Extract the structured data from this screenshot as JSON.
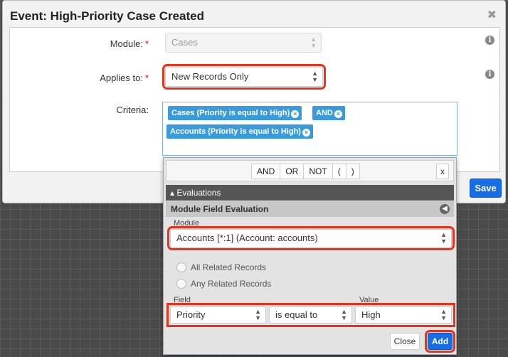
{
  "modal": {
    "title": "Event: High-Priority Case Created",
    "close_glyph": "✖",
    "save_label": "Save"
  },
  "form": {
    "module_label": "Module:",
    "module_value": "Cases",
    "applies_label": "Applies to:",
    "applies_value": "New Records Only",
    "criteria_label": "Criteria:",
    "required_mark": "*",
    "info_glyph": "i"
  },
  "criteria": {
    "pills": [
      {
        "label": "Cases (Priority is equal to High)"
      },
      {
        "label": "AND"
      },
      {
        "label": "Accounts (Priority is equal to High)"
      }
    ],
    "remove_glyph": "×"
  },
  "dropdown": {
    "operators": [
      "AND",
      "OR",
      "NOT",
      "(",
      ")"
    ],
    "close_glyph": "x",
    "evaluations_header": "▴ Evaluations",
    "section_title": "Module Field Evaluation",
    "back_glyph": "◀",
    "module_label": "Module",
    "module_value": "Accounts [*:1] (Account: accounts)",
    "radio_all": "All Related Records",
    "radio_any": "Any Related Records",
    "field_label": "Field",
    "value_label": "Value",
    "field_value": "Priority",
    "operator_value": "is equal to",
    "value_value": "High",
    "close_label": "Close",
    "add_label": "Add"
  },
  "colors": {
    "accent": "#176de5",
    "pill": "#3a9bdc",
    "highlight": "#e8321b",
    "required": "#d0021b"
  }
}
